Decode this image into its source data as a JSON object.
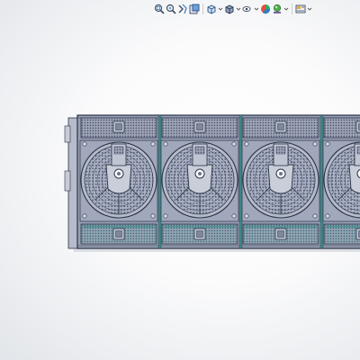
{
  "viewport": {
    "background": "#f4f5f7"
  },
  "hud_toolbar": {
    "tools": [
      {
        "name": "zoom-to-fit",
        "icon": "zoom-to-fit-icon"
      },
      {
        "name": "zoom-to-area",
        "icon": "zoom-to-area-icon"
      },
      {
        "name": "previous-view",
        "icon": "previous-view-icon"
      },
      {
        "name": "section-view",
        "icon": "section-view-icon"
      },
      {
        "name": "view-orientation",
        "icon": "view-orientation-icon"
      },
      {
        "name": "display-style",
        "icon": "display-style-icon"
      },
      {
        "name": "hide-show-items",
        "icon": "hide-show-items-icon"
      },
      {
        "name": "edit-appearance",
        "icon": "edit-appearance-icon"
      },
      {
        "name": "apply-scene",
        "icon": "apply-scene-icon"
      },
      {
        "name": "view-settings",
        "icon": "view-settings-icon"
      }
    ]
  },
  "model": {
    "module_count": 4,
    "colors": {
      "body": "#9aa1b7",
      "outline": "#2a3345",
      "accent_teal": "#3f8a8a",
      "grille": "#5a6178",
      "shadow": "#c9ced6"
    }
  }
}
